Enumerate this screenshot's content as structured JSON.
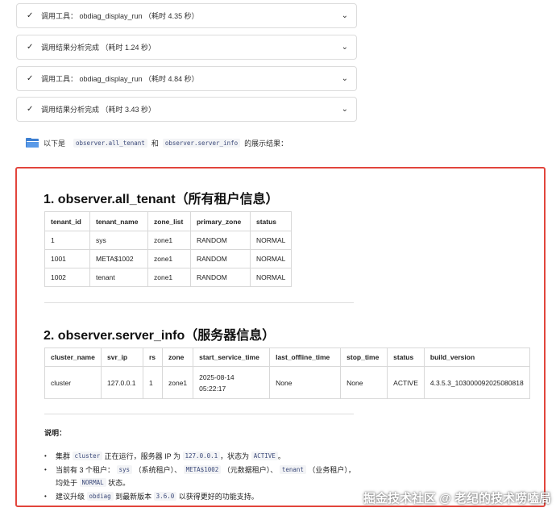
{
  "steps": [
    {
      "label": "调用工具： obdiag_display_run （耗时 4.35 秒）"
    },
    {
      "label": "调用结果分析完成 （耗时 1.24 秒）"
    },
    {
      "label": "调用工具： obdiag_display_run （耗时 4.84 秒）"
    },
    {
      "label": "调用结果分析完成 （耗时 3.43 秒）"
    }
  ],
  "intro": {
    "icon": "folder-icon",
    "prefix": "以下是",
    "code1": "observer.all_tenant",
    "and": "和",
    "code2": "observer.server_info",
    "suffix": "的展示结果："
  },
  "section1": {
    "title": "1. observer.all_tenant（所有租户信息）",
    "columns": [
      "tenant_id",
      "tenant_name",
      "zone_list",
      "primary_zone",
      "status"
    ],
    "rows": [
      [
        "1",
        "sys",
        "zone1",
        "RANDOM",
        "NORMAL"
      ],
      [
        "1001",
        "META$1002",
        "zone1",
        "RANDOM",
        "NORMAL"
      ],
      [
        "1002",
        "tenant",
        "zone1",
        "RANDOM",
        "NORMAL"
      ]
    ]
  },
  "section2": {
    "title": "2. observer.server_info（服务器信息）",
    "columns": [
      "cluster_name",
      "svr_ip",
      "rs",
      "zone",
      "start_service_time",
      "last_offline_time",
      "stop_time",
      "status",
      "build_version"
    ],
    "row": {
      "cluster_name": "cluster",
      "svr_ip": "127.0.0.1",
      "rs": "1",
      "zone": "zone1",
      "start_date": "2025-08-14",
      "start_time": "05:22:17",
      "last_offline_time": "None",
      "stop_time": "None",
      "status": "ACTIVE",
      "build_version": "4.3.5.3_103000092025080818"
    }
  },
  "notes": {
    "title": "说明：",
    "n1": {
      "a": "集群",
      "c1": "cluster",
      "b": "正在运行，服务器 IP 为",
      "c2": "127.0.0.1",
      "d": "，状态为",
      "c3": "ACTIVE",
      "e": "。"
    },
    "n2": {
      "a": "当前有 3 个租户：",
      "c1": "sys",
      "b": "（系统租户）、",
      "c2": "META$1002",
      "d": "（元数据租户）、",
      "c3": "tenant",
      "e": "（业务租户），"
    },
    "n2b": {
      "a": "均处于",
      "c1": "NORMAL",
      "b": "状态。"
    },
    "n3": {
      "a": "建议升级",
      "c1": "obdiag",
      "b": "到最新版本",
      "c2": "3.6.0",
      "d": "以获得更好的功能支持。"
    }
  },
  "watermark": "掘金技术社区 @ 老纪的技术唠嗑局",
  "colors": {
    "highlight_border": "#e2453c",
    "code_bg": "#f3f4f6"
  }
}
